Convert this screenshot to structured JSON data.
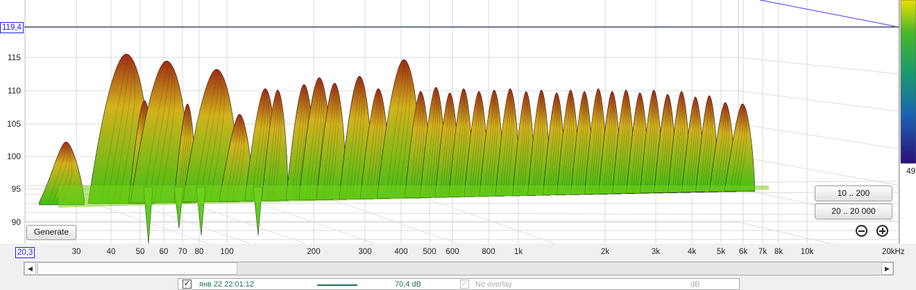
{
  "y_axis": {
    "ticks": [
      "115",
      "110",
      "105",
      "100",
      "95",
      "90"
    ],
    "top_readout": "119,4"
  },
  "x_axis": {
    "start_readout": "20,3",
    "ticks": [
      "30",
      "40",
      "50",
      "60",
      "70",
      "80",
      "100",
      "200",
      "300",
      "400",
      "500",
      "600",
      "800",
      "1k",
      "2k",
      "3k",
      "4k",
      "5k",
      "6k",
      "7k",
      "8k",
      "10k",
      "20kHz"
    ]
  },
  "colorbar": {
    "bottom_label": "49"
  },
  "buttons": {
    "generate": "Generate",
    "range1": "10 .. 200",
    "range2": "20 .. 20 000"
  },
  "legend": {
    "item_name": "янв 22 22:01:12",
    "item_value": "70,4 dB",
    "overlay_label": "No overlay",
    "unit": "dB",
    "item_checked": "✓",
    "line_color": "#1e6b5a"
  },
  "scrollbar": {
    "left_arrow": "◀",
    "right_arrow": "▶"
  },
  "colors": {
    "accent": "#1a1adf",
    "low": "#4bd01a",
    "mid": "#d8c21a",
    "high": "#b3221a"
  }
}
